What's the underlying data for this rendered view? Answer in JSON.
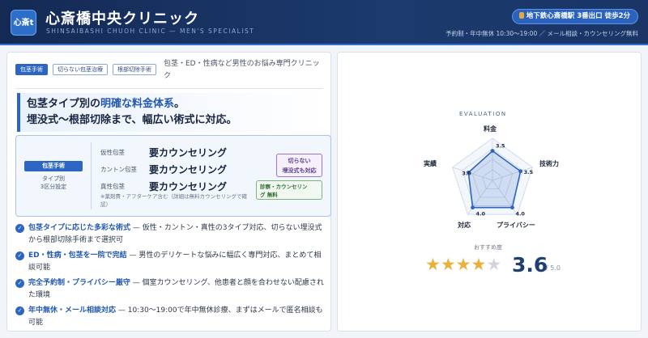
{
  "header": {
    "logo_text": "心斎t",
    "clinic_name": "心斎橋中央クリニック",
    "clinic_subtitle": "SHINSAIBASHI CHUOH CLINIC — MEN'S SPECIALIST",
    "access": "地下鉄心斎橋駅 3番出口 徒歩2分",
    "hours": "予約制・年中無休 10:30〜19:00 ／ メール相談・カウンセリング無料"
  },
  "tags": [
    "包茎手術",
    "切らない包茎治療",
    "根部切除手術"
  ],
  "tag_desc": "包茎・ED・性病など男性のお悩み専門クリニック",
  "headline": {
    "l1_a": "包茎タイプ別の",
    "l1_hl": "明確な料金体系",
    "l1_b": "。",
    "l2": "埋没式〜根部切除まで、幅広い術式に対応。"
  },
  "price_box": {
    "badge": "包茎手術",
    "type_note_1": "タイプ別",
    "type_note_2": "3区分設定",
    "rows": [
      {
        "label": "仮性包茎",
        "value": "要カウンセリング"
      },
      {
        "label": "カントン包茎",
        "value": "要カウンセリング"
      },
      {
        "label": "真性包茎",
        "value": "要カウンセリング"
      }
    ],
    "note": "※薬剤費・アフターケア含む（詳細は無料カウンセリングで確認）",
    "pill_a_1": "切らない",
    "pill_a_2": "埋没式も対応",
    "pill_b_1": "診察・カウンセリン",
    "pill_b_2": "グ 無料"
  },
  "features": [
    {
      "title": "包茎タイプに応じた多彩な術式",
      "text": " — 仮性・カントン・真性の3タイプ対応、切らない埋没式から根部切除手術まで選択可"
    },
    {
      "title": "ED・性病・包茎を一院で完結",
      "text": " — 男性のデリケートな悩みに幅広く専門対応、まとめて相談可能"
    },
    {
      "title": "完全予約制・プライバシー厳守",
      "text": " — 個室カウンセリング、他患者と顔を合わせない配慮された環境"
    },
    {
      "title": "年中無休・メール相談対応",
      "text": " — 10:30〜19:00で年中無休診療、まずはメールで匿名相談も可能"
    }
  ],
  "evaluation": {
    "heading": "EVALUATION",
    "axes": [
      {
        "label": "料金",
        "value": 3.5
      },
      {
        "label": "技術力",
        "value": 3.5
      },
      {
        "label": "プライバシー",
        "value": 4.0
      },
      {
        "label": "対応",
        "value": 4.0
      },
      {
        "label": "実績",
        "value": 3.0
      }
    ],
    "max": 5,
    "recommend_label": "おすすめ度",
    "score": "3.6",
    "out_of": "/ 5.0",
    "stars_filled": 4,
    "stars_total": 5,
    "accent": "#2c66c2"
  }
}
